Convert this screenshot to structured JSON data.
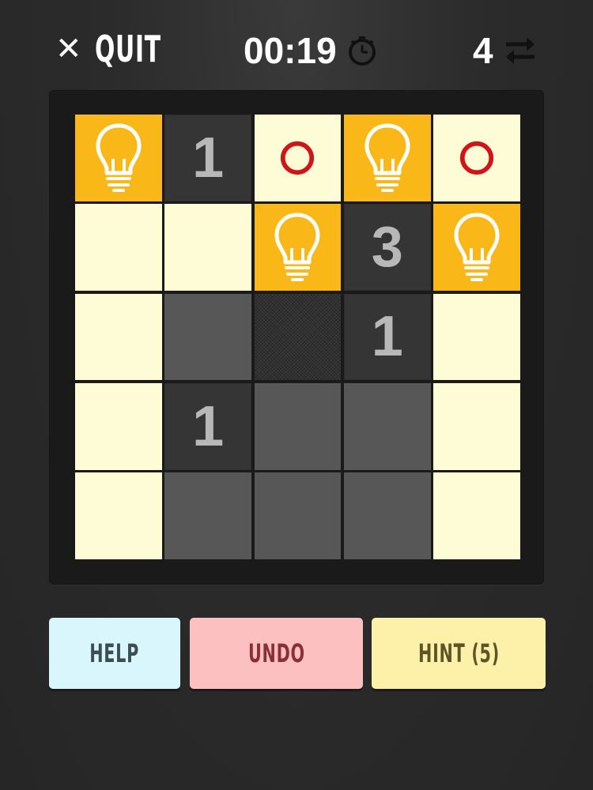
{
  "header": {
    "quit_icon": "close-icon",
    "quit_label": "QUIT",
    "timer": "00:19",
    "timer_icon": "stopwatch-icon",
    "moves_count": "4",
    "moves_icon": "swap-arrows-icon"
  },
  "board": {
    "rows": 5,
    "cols": 5,
    "cells": [
      [
        {
          "type": "bulb"
        },
        {
          "type": "wall",
          "num": "1"
        },
        {
          "type": "lit",
          "mark": "circle"
        },
        {
          "type": "bulb"
        },
        {
          "type": "lit",
          "mark": "circle"
        }
      ],
      [
        {
          "type": "lit"
        },
        {
          "type": "lit"
        },
        {
          "type": "bulb"
        },
        {
          "type": "wall",
          "num": "3"
        },
        {
          "type": "bulb"
        }
      ],
      [
        {
          "type": "lit"
        },
        {
          "type": "dark"
        },
        {
          "type": "dark-hatched"
        },
        {
          "type": "wall",
          "num": "1"
        },
        {
          "type": "lit"
        }
      ],
      [
        {
          "type": "lit"
        },
        {
          "type": "wall",
          "num": "1"
        },
        {
          "type": "dark"
        },
        {
          "type": "dark"
        },
        {
          "type": "lit"
        }
      ],
      [
        {
          "type": "lit"
        },
        {
          "type": "dark"
        },
        {
          "type": "dark"
        },
        {
          "type": "dark"
        },
        {
          "type": "lit"
        }
      ]
    ]
  },
  "buttons": {
    "help_label": "HELP",
    "undo_label": "UNDO",
    "hint_label": "HINT (5)"
  },
  "colors": {
    "lit": "#fdfcd6",
    "bulb": "#fab818",
    "wall": "#353535",
    "dark": "#575757",
    "mark": "#d0151a",
    "help": "#d8f6fc",
    "undo": "#fcc0c0",
    "hint": "#fdf0a8"
  }
}
